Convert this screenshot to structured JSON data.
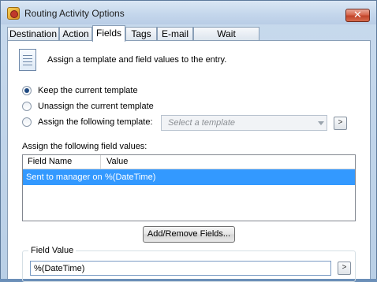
{
  "window": {
    "title": "Routing Activity Options",
    "close_glyph": "✕"
  },
  "tabs": [
    {
      "label": "Destination",
      "active": false
    },
    {
      "label": "Action",
      "active": false
    },
    {
      "label": "Fields",
      "active": true
    },
    {
      "label": "Tags",
      "active": false
    },
    {
      "label": "E-mail",
      "active": false
    },
    {
      "label": "Wait Conditions",
      "active": false
    }
  ],
  "intro": {
    "icon": "document-icon",
    "text": "Assign a template and field values to the entry."
  },
  "template_options": {
    "keep_label": "Keep the current template",
    "unassign_label": "Unassign the current template",
    "assign_label": "Assign the following template:",
    "selected": "keep",
    "template_placeholder": "Select a template",
    "browse_glyph": ">"
  },
  "field_values": {
    "label": "Assign the following field values:",
    "columns": [
      "Field Name",
      "Value"
    ],
    "rows": [
      {
        "field_name": "Sent to manager on",
        "value": "%(DateTime)",
        "selected": true
      }
    ],
    "add_remove_label": "Add/Remove Fields..."
  },
  "field_value": {
    "group_label": "Field Value",
    "value": "%(DateTime)",
    "browse_glyph": ">"
  },
  "colors": {
    "selection": "#3399ff",
    "title_bar": "#c5d7ec",
    "close_button": "#c1442b"
  }
}
